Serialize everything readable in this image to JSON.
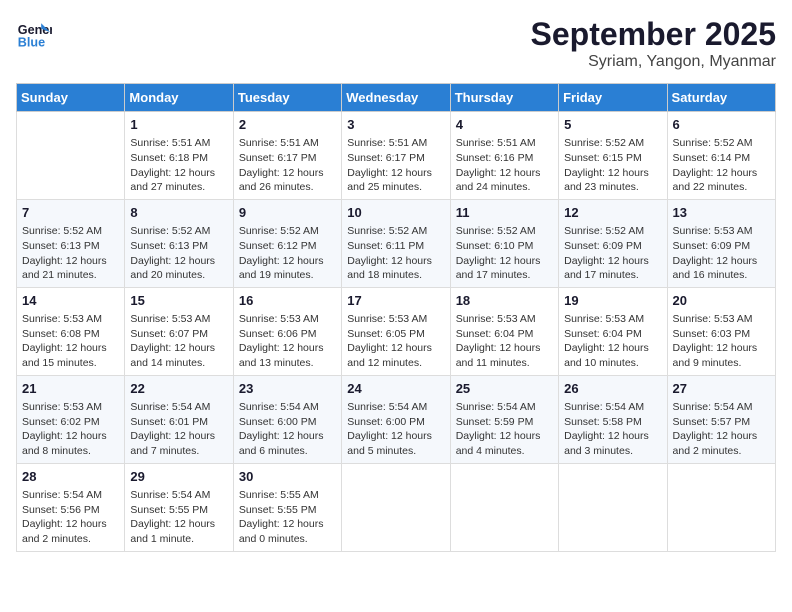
{
  "header": {
    "logo_line1": "General",
    "logo_line2": "Blue",
    "month": "September 2025",
    "location": "Syriam, Yangon, Myanmar"
  },
  "days_of_week": [
    "Sunday",
    "Monday",
    "Tuesday",
    "Wednesday",
    "Thursday",
    "Friday",
    "Saturday"
  ],
  "weeks": [
    [
      {
        "day": "",
        "info": ""
      },
      {
        "day": "1",
        "info": "Sunrise: 5:51 AM\nSunset: 6:18 PM\nDaylight: 12 hours\nand 27 minutes."
      },
      {
        "day": "2",
        "info": "Sunrise: 5:51 AM\nSunset: 6:17 PM\nDaylight: 12 hours\nand 26 minutes."
      },
      {
        "day": "3",
        "info": "Sunrise: 5:51 AM\nSunset: 6:17 PM\nDaylight: 12 hours\nand 25 minutes."
      },
      {
        "day": "4",
        "info": "Sunrise: 5:51 AM\nSunset: 6:16 PM\nDaylight: 12 hours\nand 24 minutes."
      },
      {
        "day": "5",
        "info": "Sunrise: 5:52 AM\nSunset: 6:15 PM\nDaylight: 12 hours\nand 23 minutes."
      },
      {
        "day": "6",
        "info": "Sunrise: 5:52 AM\nSunset: 6:14 PM\nDaylight: 12 hours\nand 22 minutes."
      }
    ],
    [
      {
        "day": "7",
        "info": "Sunrise: 5:52 AM\nSunset: 6:13 PM\nDaylight: 12 hours\nand 21 minutes."
      },
      {
        "day": "8",
        "info": "Sunrise: 5:52 AM\nSunset: 6:13 PM\nDaylight: 12 hours\nand 20 minutes."
      },
      {
        "day": "9",
        "info": "Sunrise: 5:52 AM\nSunset: 6:12 PM\nDaylight: 12 hours\nand 19 minutes."
      },
      {
        "day": "10",
        "info": "Sunrise: 5:52 AM\nSunset: 6:11 PM\nDaylight: 12 hours\nand 18 minutes."
      },
      {
        "day": "11",
        "info": "Sunrise: 5:52 AM\nSunset: 6:10 PM\nDaylight: 12 hours\nand 17 minutes."
      },
      {
        "day": "12",
        "info": "Sunrise: 5:52 AM\nSunset: 6:09 PM\nDaylight: 12 hours\nand 17 minutes."
      },
      {
        "day": "13",
        "info": "Sunrise: 5:53 AM\nSunset: 6:09 PM\nDaylight: 12 hours\nand 16 minutes."
      }
    ],
    [
      {
        "day": "14",
        "info": "Sunrise: 5:53 AM\nSunset: 6:08 PM\nDaylight: 12 hours\nand 15 minutes."
      },
      {
        "day": "15",
        "info": "Sunrise: 5:53 AM\nSunset: 6:07 PM\nDaylight: 12 hours\nand 14 minutes."
      },
      {
        "day": "16",
        "info": "Sunrise: 5:53 AM\nSunset: 6:06 PM\nDaylight: 12 hours\nand 13 minutes."
      },
      {
        "day": "17",
        "info": "Sunrise: 5:53 AM\nSunset: 6:05 PM\nDaylight: 12 hours\nand 12 minutes."
      },
      {
        "day": "18",
        "info": "Sunrise: 5:53 AM\nSunset: 6:04 PM\nDaylight: 12 hours\nand 11 minutes."
      },
      {
        "day": "19",
        "info": "Sunrise: 5:53 AM\nSunset: 6:04 PM\nDaylight: 12 hours\nand 10 minutes."
      },
      {
        "day": "20",
        "info": "Sunrise: 5:53 AM\nSunset: 6:03 PM\nDaylight: 12 hours\nand 9 minutes."
      }
    ],
    [
      {
        "day": "21",
        "info": "Sunrise: 5:53 AM\nSunset: 6:02 PM\nDaylight: 12 hours\nand 8 minutes."
      },
      {
        "day": "22",
        "info": "Sunrise: 5:54 AM\nSunset: 6:01 PM\nDaylight: 12 hours\nand 7 minutes."
      },
      {
        "day": "23",
        "info": "Sunrise: 5:54 AM\nSunset: 6:00 PM\nDaylight: 12 hours\nand 6 minutes."
      },
      {
        "day": "24",
        "info": "Sunrise: 5:54 AM\nSunset: 6:00 PM\nDaylight: 12 hours\nand 5 minutes."
      },
      {
        "day": "25",
        "info": "Sunrise: 5:54 AM\nSunset: 5:59 PM\nDaylight: 12 hours\nand 4 minutes."
      },
      {
        "day": "26",
        "info": "Sunrise: 5:54 AM\nSunset: 5:58 PM\nDaylight: 12 hours\nand 3 minutes."
      },
      {
        "day": "27",
        "info": "Sunrise: 5:54 AM\nSunset: 5:57 PM\nDaylight: 12 hours\nand 2 minutes."
      }
    ],
    [
      {
        "day": "28",
        "info": "Sunrise: 5:54 AM\nSunset: 5:56 PM\nDaylight: 12 hours\nand 2 minutes."
      },
      {
        "day": "29",
        "info": "Sunrise: 5:54 AM\nSunset: 5:55 PM\nDaylight: 12 hours\nand 1 minute."
      },
      {
        "day": "30",
        "info": "Sunrise: 5:55 AM\nSunset: 5:55 PM\nDaylight: 12 hours\nand 0 minutes."
      },
      {
        "day": "",
        "info": ""
      },
      {
        "day": "",
        "info": ""
      },
      {
        "day": "",
        "info": ""
      },
      {
        "day": "",
        "info": ""
      }
    ]
  ]
}
